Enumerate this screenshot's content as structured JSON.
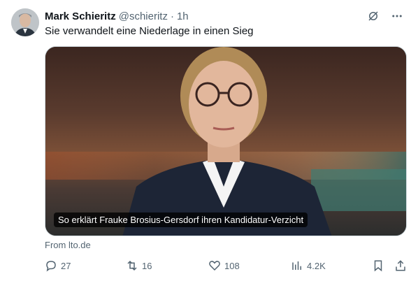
{
  "tweet": {
    "author_name": "Mark Schieritz",
    "handle": "@schieritz",
    "separator": "·",
    "time": "1h",
    "text": "Sie verwandelt eine Niederlage in einen Sieg",
    "media_caption": "So erklärt Frauke Brosius-Gersdorf ihren Kandidatur-Verzicht",
    "from_label": "From lto.de"
  },
  "actions": {
    "replies": "27",
    "reposts": "16",
    "likes": "108",
    "views": "4.2K"
  },
  "icons": {
    "grok": "grok-icon",
    "more": "more-icon",
    "reply": "reply-icon",
    "repost": "repost-icon",
    "like": "like-icon",
    "views": "views-icon",
    "bookmark": "bookmark-icon",
    "share": "share-icon"
  },
  "colors": {
    "text": "#0f1419",
    "secondary": "#536471",
    "border": "#cfd9de"
  }
}
